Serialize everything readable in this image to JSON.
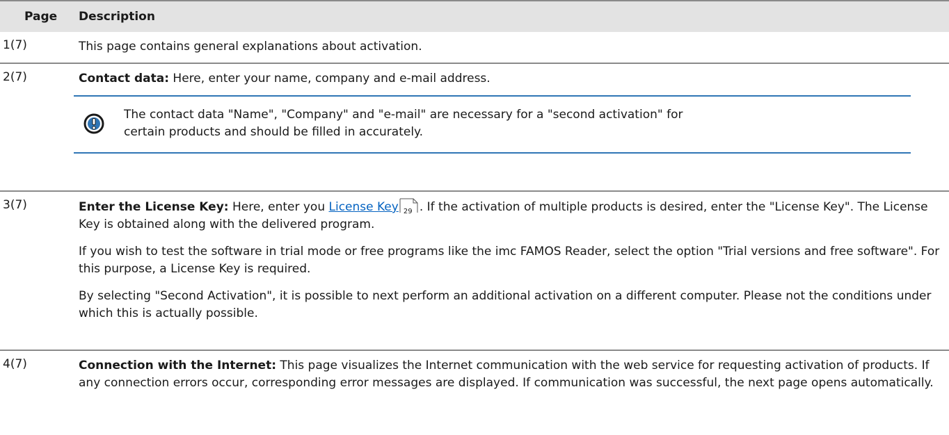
{
  "header": {
    "page_col": "Page",
    "description_col": "Description"
  },
  "rows": [
    {
      "page": "1(7)",
      "text": "This page contains general explanations about activation."
    },
    {
      "page": "2(7)",
      "bold": "Contact data:",
      "text": " Here, enter your name, company and e-mail address.",
      "note": {
        "icon": "exclamation-circle-icon",
        "line1": "The contact data \"Name\", \"Company\" and \"e-mail\" are necessary for a \"second activation\" for",
        "line2": "certain products and should be filled in accurately."
      }
    },
    {
      "page": "3(7)",
      "bold": "Enter the License Key:",
      "text_before_link": " Here, enter you ",
      "link": "License Key",
      "link_page": "29",
      "text_after_link": ". If the activation of multiple products is desired, enter the \"License Key\". The License Key is obtained along with the delivered program.",
      "para2": "If you wish to test the software in trial mode or free programs like the imc FAMOS Reader, select the option \"Trial versions and free software\". For this purpose, a License Key is required.",
      "para3": "By selecting \"Second Activation\", it is possible to next perform an additional activation on a different computer. Please not the conditions under which this is actually possible."
    },
    {
      "page": "4(7)",
      "bold": "Connection with the Internet:",
      "text": " This page visualizes the Internet communication with the web service for requesting activation of products. If any connection errors occur, corresponding error messages are displayed. If communication was successful, the next page opens automatically."
    }
  ],
  "colors": {
    "header_bg": "#e3e3e3",
    "rule": "#8a8a8a",
    "note_rule": "#2f75b5",
    "link": "#0563c1"
  }
}
